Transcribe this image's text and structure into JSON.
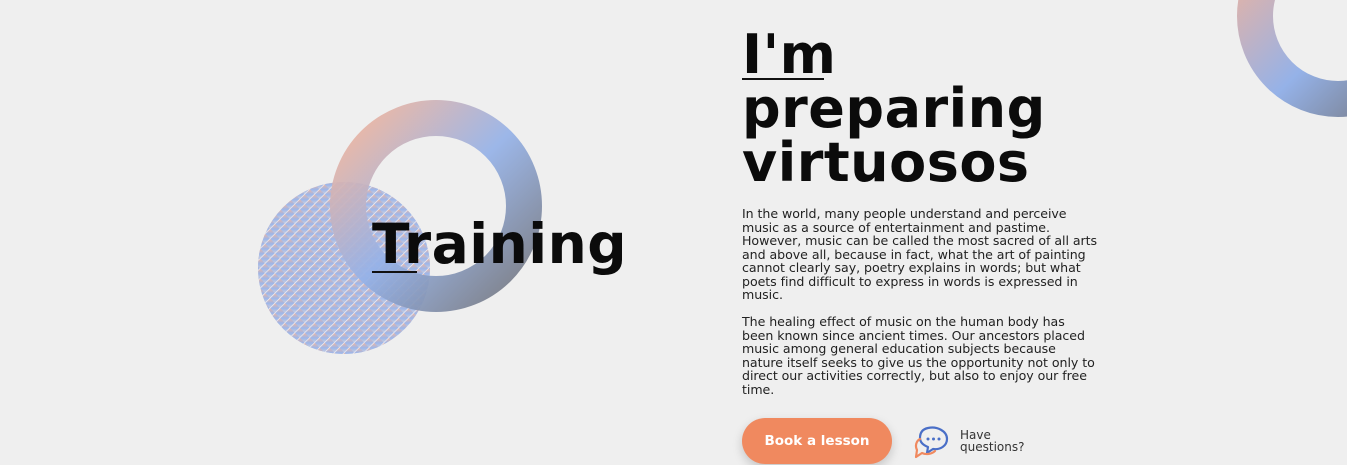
{
  "section": {
    "title": "Training"
  },
  "hero": {
    "title_lines": [
      "I'm",
      "preparing",
      "virtuosos"
    ],
    "paragraphs": [
      "In the world, many people understand and perceive music as a source of entertainment and pastime. However, music can be called the most sacred of all arts and above all, because in fact, what the art of painting cannot clearly say, poetry explains in words; but what poets find difficult to express in words is expressed in music.",
      "The healing effect of music on the human body has been known since ancient times. Our ancestors placed music among general education subjects because nature itself seeks to give us the opportunity not only to direct our activities correctly, but also to enjoy our free time."
    ]
  },
  "actions": {
    "book_label": "Book a lesson",
    "questions_label": "Have questions?"
  },
  "colors": {
    "accent": "#f0895f",
    "gradient_peach": "#f0b59a",
    "gradient_blue": "#8fb0e6",
    "gradient_gray": "#7b7e86"
  }
}
